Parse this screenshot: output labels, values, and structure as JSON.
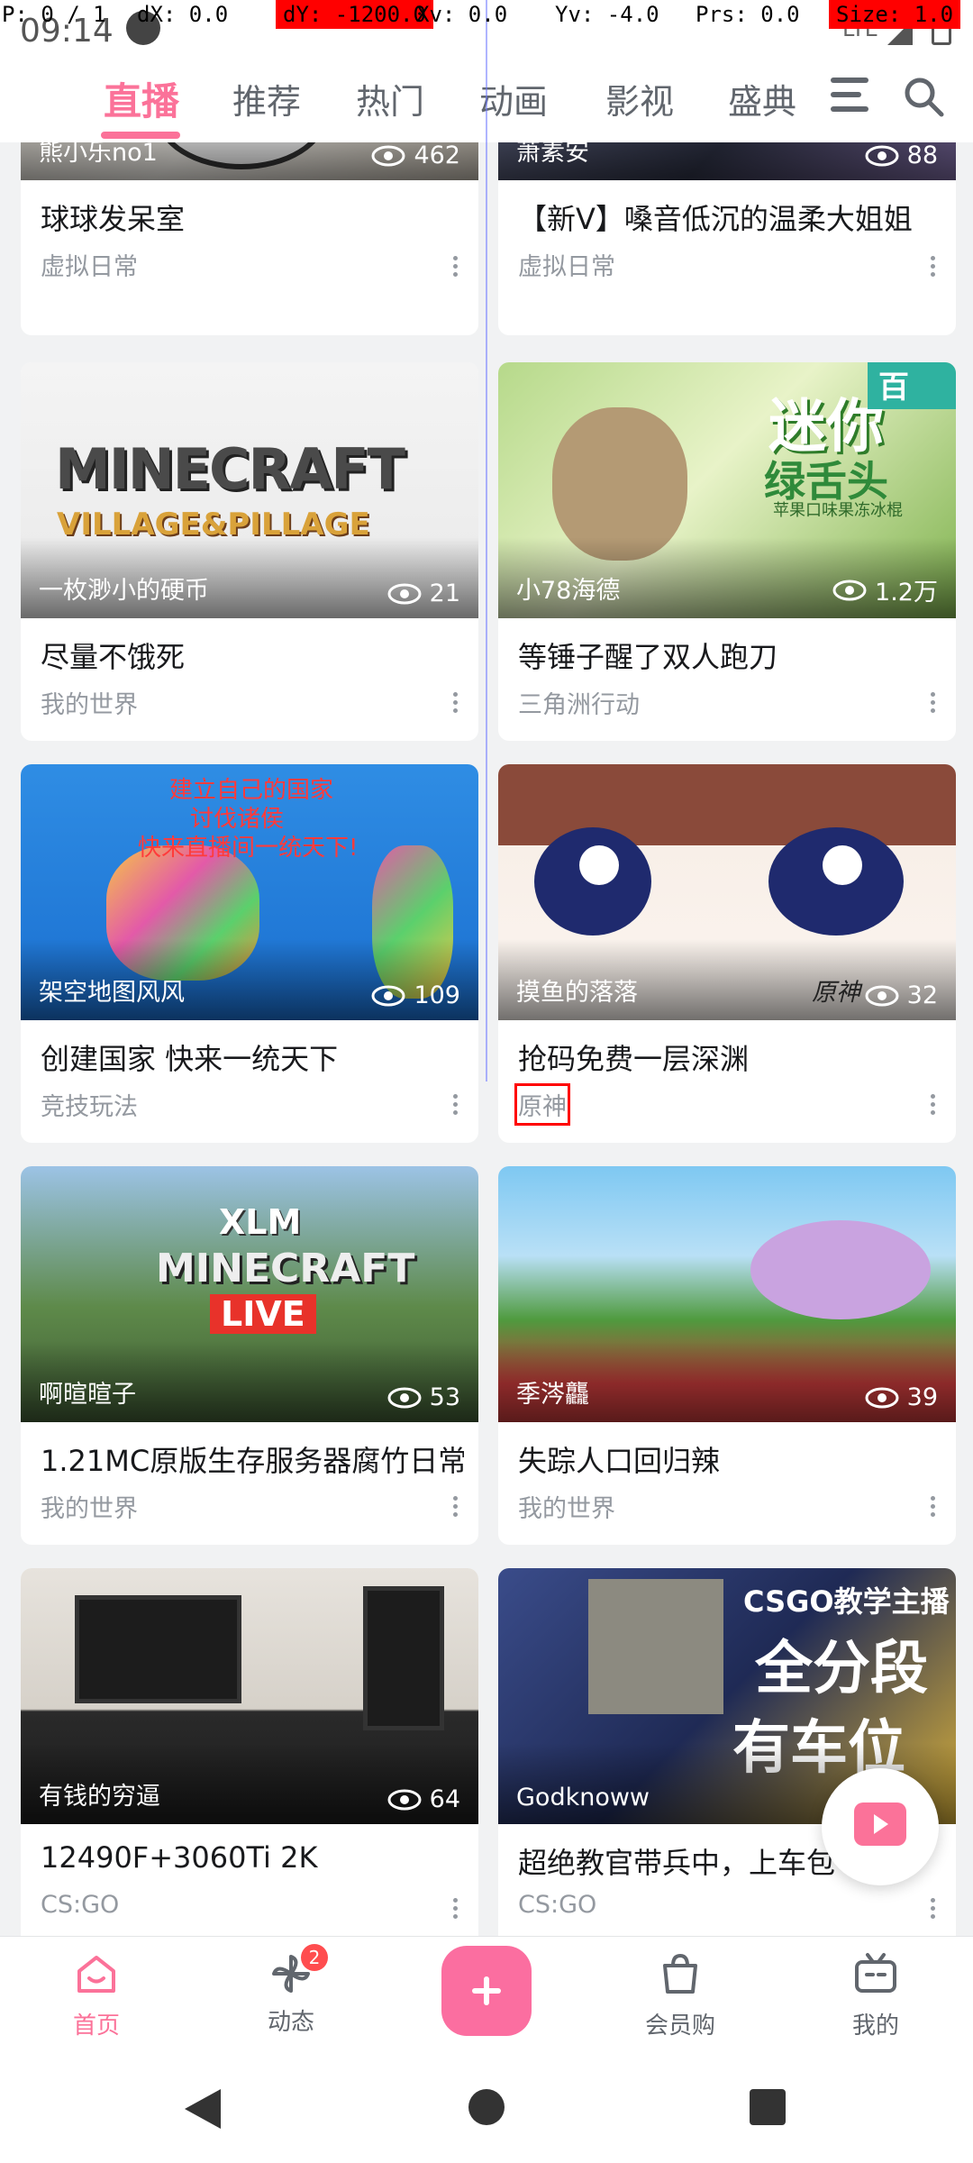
{
  "debug": {
    "p": "P: 0 / 1",
    "dx": "dX: 0.0",
    "dy": "dY: -1200.0",
    "xv": "Xv: 0.0",
    "yv": "Yv: -4.0",
    "prs": "Prs: 0.0",
    "size": "Size: 1.0"
  },
  "status_bar": {
    "time": "09:14",
    "network": "LTE"
  },
  "top_tabs": {
    "items": [
      "直播",
      "推荐",
      "热门",
      "动画",
      "影视",
      "盛典"
    ],
    "active": "直播"
  },
  "cards": [
    {
      "uploader": "熊小乐no1",
      "views": "462",
      "title": "球球发呆室",
      "category": "虚拟日常"
    },
    {
      "uploader": "萧素安",
      "views": "88",
      "title": "【新V】嗓音低沉的温柔大姐姐",
      "category": "虚拟日常"
    },
    {
      "uploader": "一枚渺小的硬币",
      "views": "21",
      "title": "尽量不饿死",
      "category": "我的世界",
      "thumb_text_1": "MINECRAFT",
      "thumb_text_2": "VILLAGE&PILLAGE"
    },
    {
      "uploader": "小78海德",
      "views": "1.2万",
      "title": "等锤子醒了双人跑刀",
      "category": "三角洲行动",
      "thumb_text_1": "迷你",
      "thumb_text_2": "绿舌头",
      "thumb_text_3": "苹果口味果冻冰棍",
      "thumb_tag": "百"
    },
    {
      "uploader": "架空地图风风",
      "views": "109",
      "title": "创建国家 快来一统天下",
      "category": "竞技玩法",
      "thumb_text_1": "建立自己的国家",
      "thumb_text_2": "讨伐诸侯",
      "thumb_text_3": "快来直播间一统天下!"
    },
    {
      "uploader": "摸鱼的落落",
      "views": "32",
      "title": "抢码免费一层深渊",
      "category": "原神",
      "thumb_text_1": "原神"
    },
    {
      "uploader": "啊暄暄子",
      "views": "53",
      "title": "1.21MC原版生存服务器腐竹日常",
      "category": "我的世界",
      "thumb_text_1": "XLM",
      "thumb_text_2": "MINECRAFT",
      "thumb_text_3": "LIVE"
    },
    {
      "uploader": "季涔龘",
      "views": "39",
      "title": "失踪人口回归辣",
      "category": "我的世界"
    },
    {
      "uploader": "有钱的穷逼",
      "views": "64",
      "title": "12490F+3060Ti 2K",
      "category": "CS:GO"
    },
    {
      "uploader": "Godknoww",
      "views": "",
      "title": "超绝教官带兵中，上车包",
      "category": "CS:GO",
      "thumb_text_1": "CSGO教学主播",
      "thumb_text_2": "全分段",
      "thumb_text_3": "有车位"
    }
  ],
  "bottom_nav": {
    "home": "首页",
    "dynamic": "动态",
    "dynamic_badge": "2",
    "vip_shop": "会员购",
    "mine": "我的"
  },
  "colors": {
    "accent": "#fb7299",
    "text_secondary": "#9499a0"
  }
}
